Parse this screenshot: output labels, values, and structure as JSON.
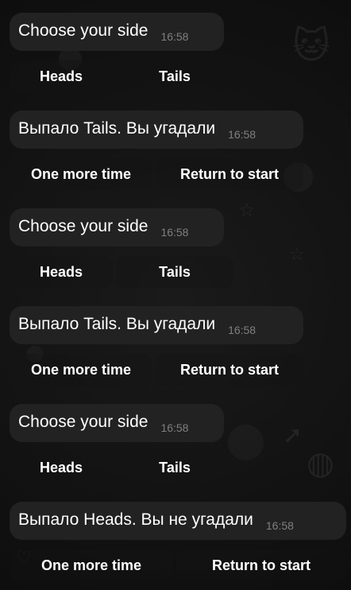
{
  "messages": [
    {
      "text": "Choose your side",
      "time": "16:58",
      "buttons": [
        "Heads",
        "Tails"
      ]
    },
    {
      "text": "Выпало Tails. Вы угадали",
      "time": "16:58",
      "buttons": [
        "One more time",
        "Return to start"
      ]
    },
    {
      "text": "Choose your side",
      "time": "16:58",
      "buttons": [
        "Heads",
        "Tails"
      ]
    },
    {
      "text": "Выпало Tails. Вы угадали",
      "time": "16:58",
      "buttons": [
        "One more time",
        "Return to start"
      ]
    },
    {
      "text": "Choose your side",
      "time": "16:58",
      "buttons": [
        "Heads",
        "Tails"
      ]
    },
    {
      "text": "Выпало Heads. Вы не угадали",
      "time": "16:58",
      "buttons": [
        "One more time",
        "Return to start"
      ]
    }
  ],
  "background": {
    "color": "#111111",
    "bubble_color": "#222222",
    "time_color": "#7f7f7f",
    "text_color": "#ffffff",
    "pattern": "doodle-wallpaper"
  }
}
